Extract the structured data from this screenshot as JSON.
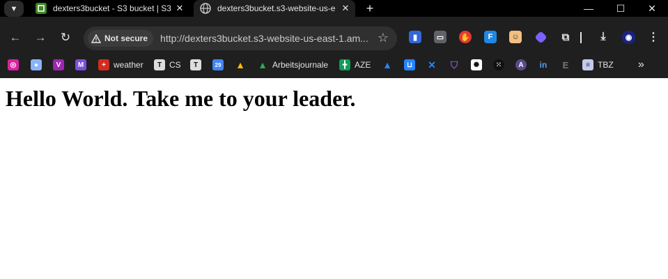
{
  "tabstrip": {
    "tabs": [
      {
        "title": "dexters3bucket - S3 bucket | S3",
        "icon": "s3-icon",
        "active": false
      },
      {
        "title": "dexters3bucket.s3-website-us-e",
        "icon": "globe-icon",
        "active": true
      }
    ],
    "new_tab_symbol": "+",
    "window": {
      "minimize": "—",
      "maximize": "☐",
      "close": "✕"
    }
  },
  "toolbar": {
    "security_label": "Not secure",
    "url": "http://dexters3bucket.s3-website-us-east-1.am...",
    "extensions": [
      "bookmark-icon",
      "tabs-icon",
      "hand-icon",
      "translate-icon",
      "avatar-ext-icon",
      "diamond-icon",
      "puzzle-icon",
      "download-icon",
      "profile-icon",
      "menu-icon"
    ]
  },
  "bookmarks": [
    {
      "label": "",
      "icon": "instagram-icon",
      "color": "#d6249f"
    },
    {
      "label": "",
      "icon": "chat-icon",
      "color": "#8ab4f8"
    },
    {
      "label": "",
      "icon": "vault-icon",
      "color": "#9c27b0"
    },
    {
      "label": "",
      "icon": "gmail-icon",
      "color": "#c5221f"
    },
    {
      "label": "weather",
      "icon": "swiss-icon",
      "color": "#d52b1e"
    },
    {
      "label": "CS",
      "icon": "tie-icon",
      "color": "#dddddd"
    },
    {
      "label": "",
      "icon": "tie-icon",
      "color": "#dddddd"
    },
    {
      "label": "",
      "icon": "calendar-icon",
      "color": "#4285f4"
    },
    {
      "label": "",
      "icon": "drive-icon",
      "color": "#34a853"
    },
    {
      "label": "Arbeitsjournale",
      "icon": "drive-icon",
      "color": "#34a853"
    },
    {
      "label": "AZE",
      "icon": "sheet-icon",
      "color": "#0f9d58"
    },
    {
      "label": "",
      "icon": "atlassian-icon",
      "color": "#2684ff"
    },
    {
      "label": "",
      "icon": "bitbucket-icon",
      "color": "#2684ff"
    },
    {
      "label": "",
      "icon": "confluence-icon",
      "color": "#2684ff"
    },
    {
      "label": "",
      "icon": "shield-icon",
      "color": "#7e57c2"
    },
    {
      "label": "",
      "icon": "openai-icon",
      "color": "#ffffff"
    },
    {
      "label": "",
      "icon": "dots-icon",
      "color": "#111111"
    },
    {
      "label": "",
      "icon": "arc-icon",
      "color": "#5b4b8a"
    },
    {
      "label": "",
      "icon": "linkedin-icon",
      "color": "#0a66c2"
    },
    {
      "label": "",
      "icon": "e-icon",
      "color": "#555555"
    },
    {
      "label": "TBZ",
      "icon": "tbz-icon",
      "color": "#9aa0ff"
    }
  ],
  "bookmarks_overflow": "»",
  "page": {
    "heading": "Hello World. Take me to your leader."
  }
}
